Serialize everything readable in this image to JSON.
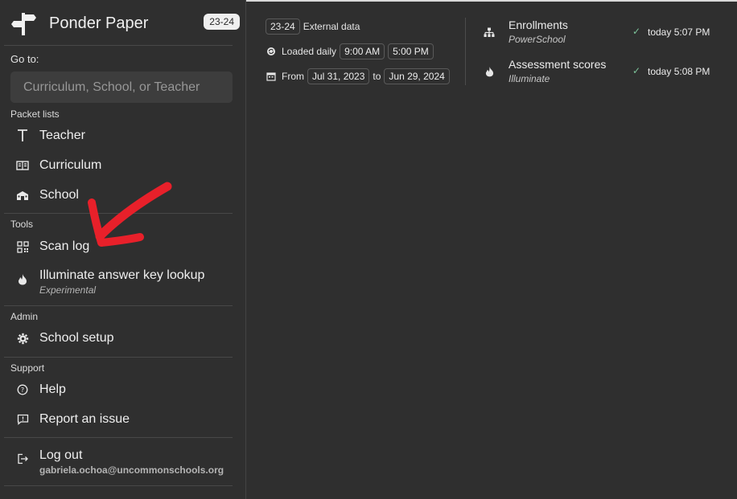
{
  "app": {
    "title": "Ponder Paper",
    "year_badge": "23-24"
  },
  "goto": {
    "label": "Go to:",
    "placeholder": "Curriculum, School, or Teacher"
  },
  "sections": {
    "packet_lists": "Packet lists",
    "tools": "Tools",
    "admin": "Admin",
    "support": "Support"
  },
  "nav": {
    "teacher": "Teacher",
    "curriculum": "Curriculum",
    "school": "School",
    "scan_log": "Scan log",
    "illuminate": "Illuminate answer key lookup",
    "illuminate_sub": "Experimental",
    "school_setup": "School setup",
    "help": "Help",
    "report": "Report an issue",
    "logout": "Log out",
    "user_email": "gabriela.ochoa@uncommonschools.org"
  },
  "external": {
    "year": "23-24",
    "label": "External data",
    "loaded_label": "Loaded daily",
    "time1": "9:00 AM",
    "time2": "5:00 PM",
    "from_label": "From",
    "start_date": "Jul 31, 2023",
    "to_label": "to",
    "end_date": "Jun 29, 2024"
  },
  "sources": [
    {
      "name": "Enrollments",
      "provider": "PowerSchool",
      "status": "today 5:07 PM",
      "icon": "hierarchy-icon"
    },
    {
      "name": "Assessment scores",
      "provider": "Illuminate",
      "status": "today 5:08 PM",
      "icon": "flame-icon"
    }
  ],
  "colors": {
    "background": "#2f2f2f",
    "annotation_arrow": "#e8202a",
    "check": "#7cc39a"
  }
}
